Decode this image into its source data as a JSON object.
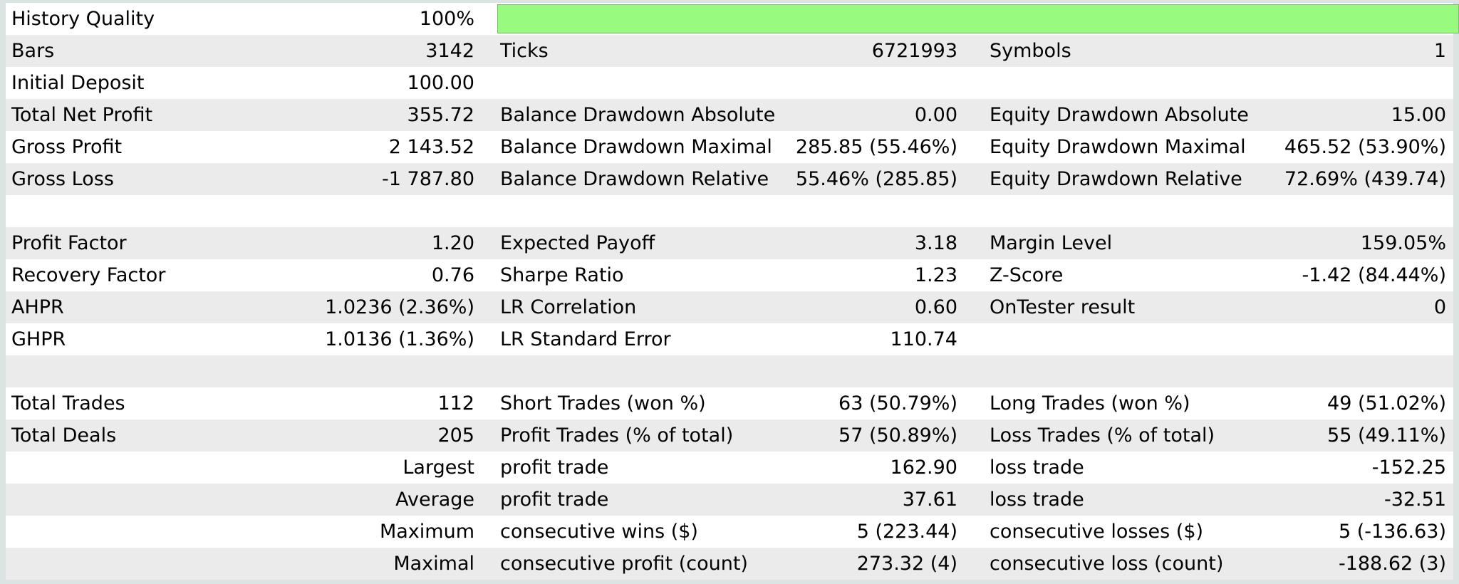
{
  "colors": {
    "bar_fill": "#98fb7f",
    "shade_row": "#ebebeb",
    "frame": "#dce3e3"
  },
  "header": {
    "history_quality_label": "History Quality",
    "history_quality_value": "100%",
    "history_quality_fraction": 1.0
  },
  "rows": [
    {
      "shade": true,
      "c1": [
        "Bars",
        "3142"
      ],
      "c2": [
        "Ticks",
        "6721993"
      ],
      "c3": [
        "Symbols",
        "1"
      ]
    },
    {
      "shade": false,
      "c1": [
        "Initial Deposit",
        "100.00"
      ],
      "c2": [
        "",
        ""
      ],
      "c3": [
        "",
        ""
      ]
    },
    {
      "shade": true,
      "c1": [
        "Total Net Profit",
        "355.72"
      ],
      "c2": [
        "Balance Drawdown Absolute",
        "0.00"
      ],
      "c3": [
        "Equity Drawdown Absolute",
        "15.00"
      ]
    },
    {
      "shade": false,
      "c1": [
        "Gross Profit",
        "2 143.52"
      ],
      "c2": [
        "Balance Drawdown Maximal",
        "285.85 (55.46%)"
      ],
      "c3": [
        "Equity Drawdown Maximal",
        "465.52 (53.90%)"
      ]
    },
    {
      "shade": true,
      "c1": [
        "Gross Loss",
        "-1 787.80"
      ],
      "c2": [
        "Balance Drawdown Relative",
        "55.46% (285.85)"
      ],
      "c3": [
        "Equity Drawdown Relative",
        "72.69% (439.74)"
      ]
    },
    {
      "shade": false,
      "c1": [
        "",
        ""
      ],
      "c2": [
        "",
        ""
      ],
      "c3": [
        "",
        ""
      ]
    },
    {
      "shade": true,
      "c1": [
        "Profit Factor",
        "1.20"
      ],
      "c2": [
        "Expected Payoff",
        "3.18"
      ],
      "c3": [
        "Margin Level",
        "159.05%"
      ]
    },
    {
      "shade": false,
      "c1": [
        "Recovery Factor",
        "0.76"
      ],
      "c2": [
        "Sharpe Ratio",
        "1.23"
      ],
      "c3": [
        "Z-Score",
        "-1.42 (84.44%)"
      ]
    },
    {
      "shade": true,
      "c1": [
        "AHPR",
        "1.0236 (2.36%)"
      ],
      "c2": [
        "LR Correlation",
        "0.60"
      ],
      "c3": [
        "OnTester result",
        "0"
      ]
    },
    {
      "shade": false,
      "c1": [
        "GHPR",
        "1.0136 (1.36%)"
      ],
      "c2": [
        "LR Standard Error",
        "110.74"
      ],
      "c3": [
        "",
        ""
      ]
    },
    {
      "shade": true,
      "c1": [
        "",
        ""
      ],
      "c2": [
        "",
        ""
      ],
      "c3": [
        "",
        ""
      ]
    },
    {
      "shade": false,
      "c1": [
        "Total Trades",
        "112"
      ],
      "c2": [
        "Short Trades (won %)",
        "63 (50.79%)"
      ],
      "c3": [
        "Long Trades (won %)",
        "49 (51.02%)"
      ]
    },
    {
      "shade": true,
      "c1": [
        "Total Deals",
        "205"
      ],
      "c2": [
        "Profit Trades (% of total)",
        "57 (50.89%)"
      ],
      "c3": [
        "Loss Trades (% of total)",
        "55 (49.11%)"
      ]
    },
    {
      "shade": false,
      "c1": [
        "",
        "Largest"
      ],
      "c2": [
        "profit trade",
        "162.90"
      ],
      "c3": [
        "loss trade",
        "-152.25"
      ]
    },
    {
      "shade": true,
      "c1": [
        "",
        "Average"
      ],
      "c2": [
        "profit trade",
        "37.61"
      ],
      "c3": [
        "loss trade",
        "-32.51"
      ]
    },
    {
      "shade": false,
      "c1": [
        "",
        "Maximum"
      ],
      "c2": [
        "consecutive wins ($)",
        "5 (223.44)"
      ],
      "c3": [
        "consecutive losses ($)",
        "5 (-136.63)"
      ]
    },
    {
      "shade": true,
      "c1": [
        "",
        "Maximal"
      ],
      "c2": [
        "consecutive profit (count)",
        "273.32 (4)"
      ],
      "c3": [
        "consecutive loss (count)",
        "-188.62 (3)"
      ]
    }
  ]
}
